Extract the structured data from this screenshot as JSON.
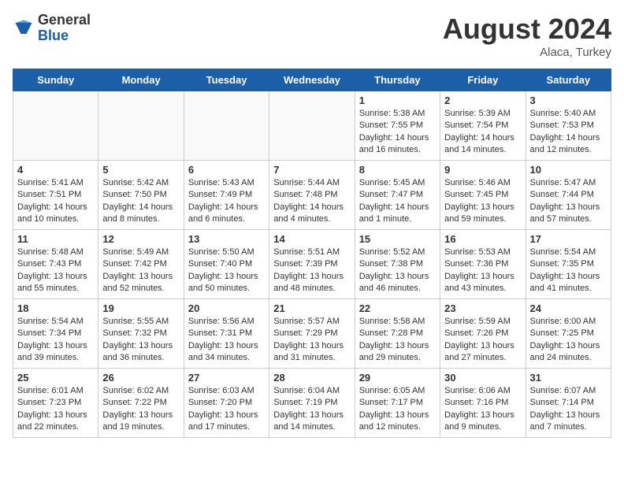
{
  "header": {
    "logo_general": "General",
    "logo_blue": "Blue",
    "month_year": "August 2024",
    "location": "Alaca, Turkey"
  },
  "weekdays": [
    "Sunday",
    "Monday",
    "Tuesday",
    "Wednesday",
    "Thursday",
    "Friday",
    "Saturday"
  ],
  "weeks": [
    [
      {
        "day": "",
        "info": ""
      },
      {
        "day": "",
        "info": ""
      },
      {
        "day": "",
        "info": ""
      },
      {
        "day": "",
        "info": ""
      },
      {
        "day": "1",
        "info": "Sunrise: 5:38 AM\nSunset: 7:55 PM\nDaylight: 14 hours\nand 16 minutes."
      },
      {
        "day": "2",
        "info": "Sunrise: 5:39 AM\nSunset: 7:54 PM\nDaylight: 14 hours\nand 14 minutes."
      },
      {
        "day": "3",
        "info": "Sunrise: 5:40 AM\nSunset: 7:53 PM\nDaylight: 14 hours\nand 12 minutes."
      }
    ],
    [
      {
        "day": "4",
        "info": "Sunrise: 5:41 AM\nSunset: 7:51 PM\nDaylight: 14 hours\nand 10 minutes."
      },
      {
        "day": "5",
        "info": "Sunrise: 5:42 AM\nSunset: 7:50 PM\nDaylight: 14 hours\nand 8 minutes."
      },
      {
        "day": "6",
        "info": "Sunrise: 5:43 AM\nSunset: 7:49 PM\nDaylight: 14 hours\nand 6 minutes."
      },
      {
        "day": "7",
        "info": "Sunrise: 5:44 AM\nSunset: 7:48 PM\nDaylight: 14 hours\nand 4 minutes."
      },
      {
        "day": "8",
        "info": "Sunrise: 5:45 AM\nSunset: 7:47 PM\nDaylight: 14 hours\nand 1 minute."
      },
      {
        "day": "9",
        "info": "Sunrise: 5:46 AM\nSunset: 7:45 PM\nDaylight: 13 hours\nand 59 minutes."
      },
      {
        "day": "10",
        "info": "Sunrise: 5:47 AM\nSunset: 7:44 PM\nDaylight: 13 hours\nand 57 minutes."
      }
    ],
    [
      {
        "day": "11",
        "info": "Sunrise: 5:48 AM\nSunset: 7:43 PM\nDaylight: 13 hours\nand 55 minutes."
      },
      {
        "day": "12",
        "info": "Sunrise: 5:49 AM\nSunset: 7:42 PM\nDaylight: 13 hours\nand 52 minutes."
      },
      {
        "day": "13",
        "info": "Sunrise: 5:50 AM\nSunset: 7:40 PM\nDaylight: 13 hours\nand 50 minutes."
      },
      {
        "day": "14",
        "info": "Sunrise: 5:51 AM\nSunset: 7:39 PM\nDaylight: 13 hours\nand 48 minutes."
      },
      {
        "day": "15",
        "info": "Sunrise: 5:52 AM\nSunset: 7:38 PM\nDaylight: 13 hours\nand 46 minutes."
      },
      {
        "day": "16",
        "info": "Sunrise: 5:53 AM\nSunset: 7:36 PM\nDaylight: 13 hours\nand 43 minutes."
      },
      {
        "day": "17",
        "info": "Sunrise: 5:54 AM\nSunset: 7:35 PM\nDaylight: 13 hours\nand 41 minutes."
      }
    ],
    [
      {
        "day": "18",
        "info": "Sunrise: 5:54 AM\nSunset: 7:34 PM\nDaylight: 13 hours\nand 39 minutes."
      },
      {
        "day": "19",
        "info": "Sunrise: 5:55 AM\nSunset: 7:32 PM\nDaylight: 13 hours\nand 36 minutes."
      },
      {
        "day": "20",
        "info": "Sunrise: 5:56 AM\nSunset: 7:31 PM\nDaylight: 13 hours\nand 34 minutes."
      },
      {
        "day": "21",
        "info": "Sunrise: 5:57 AM\nSunset: 7:29 PM\nDaylight: 13 hours\nand 31 minutes."
      },
      {
        "day": "22",
        "info": "Sunrise: 5:58 AM\nSunset: 7:28 PM\nDaylight: 13 hours\nand 29 minutes."
      },
      {
        "day": "23",
        "info": "Sunrise: 5:59 AM\nSunset: 7:26 PM\nDaylight: 13 hours\nand 27 minutes."
      },
      {
        "day": "24",
        "info": "Sunrise: 6:00 AM\nSunset: 7:25 PM\nDaylight: 13 hours\nand 24 minutes."
      }
    ],
    [
      {
        "day": "25",
        "info": "Sunrise: 6:01 AM\nSunset: 7:23 PM\nDaylight: 13 hours\nand 22 minutes."
      },
      {
        "day": "26",
        "info": "Sunrise: 6:02 AM\nSunset: 7:22 PM\nDaylight: 13 hours\nand 19 minutes."
      },
      {
        "day": "27",
        "info": "Sunrise: 6:03 AM\nSunset: 7:20 PM\nDaylight: 13 hours\nand 17 minutes."
      },
      {
        "day": "28",
        "info": "Sunrise: 6:04 AM\nSunset: 7:19 PM\nDaylight: 13 hours\nand 14 minutes."
      },
      {
        "day": "29",
        "info": "Sunrise: 6:05 AM\nSunset: 7:17 PM\nDaylight: 13 hours\nand 12 minutes."
      },
      {
        "day": "30",
        "info": "Sunrise: 6:06 AM\nSunset: 7:16 PM\nDaylight: 13 hours\nand 9 minutes."
      },
      {
        "day": "31",
        "info": "Sunrise: 6:07 AM\nSunset: 7:14 PM\nDaylight: 13 hours\nand 7 minutes."
      }
    ]
  ]
}
